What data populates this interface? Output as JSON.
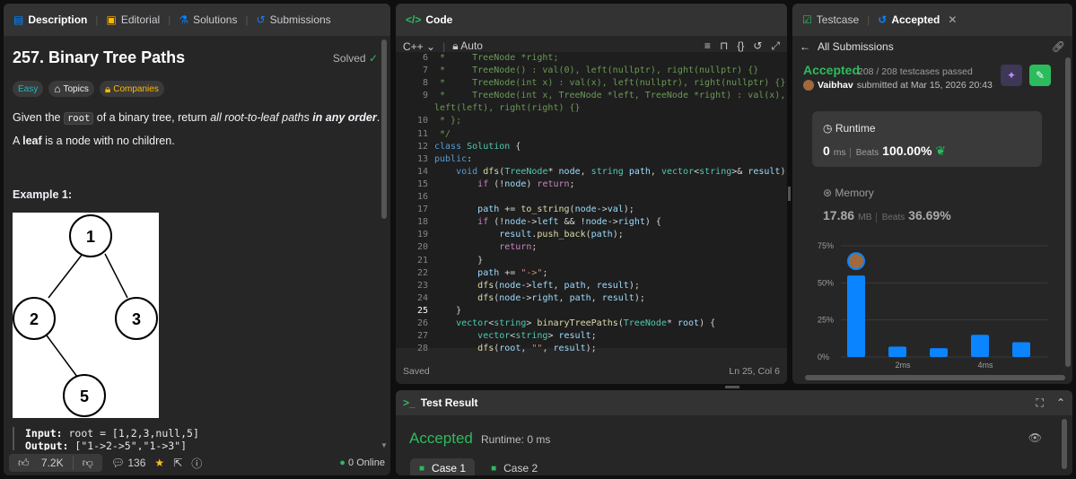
{
  "left_tabs": [
    {
      "label": "Description",
      "icon": "description-icon"
    },
    {
      "label": "Editorial",
      "icon": "editorial-icon"
    },
    {
      "label": "Solutions",
      "icon": "flask-icon"
    },
    {
      "label": "Submissions",
      "icon": "history-icon"
    }
  ],
  "problem": {
    "title": "257. Binary Tree Paths",
    "status": "Solved",
    "tags": [
      "Easy",
      "Topics",
      "Companies"
    ],
    "text_pre": "Given the ",
    "text_code": "root",
    "text_mid": " of a binary tree, return ",
    "text_em": "all root-to-leaf paths",
    "text_sp": " ",
    "text_bold_em": "in any order",
    "text_end": ".",
    "leaf_pre": "A ",
    "leaf_bold": "leaf",
    "leaf_post": " is a node with no children.",
    "example_title": "Example 1:",
    "tree_nodes": [
      "1",
      "2",
      "3",
      "5"
    ],
    "input_label": "Input:",
    "input_value": " root = [1,2,3,null,5]",
    "output_label": "Output:",
    "output_value": " [\"1->2->5\",\"1->3\"]"
  },
  "left_footer": {
    "likes": "7.2K",
    "comments": "136",
    "online": "0 Online"
  },
  "code_panel": {
    "title": "Code",
    "language": "C++",
    "mode": "Auto",
    "status": "Saved",
    "cursor": "Ln 25, Col 6",
    "line_numbers": [
      "6",
      "7",
      "8",
      "9",
      "",
      "10",
      "11",
      "12",
      "13",
      "14",
      "15",
      "16",
      "17",
      "18",
      "19",
      "20",
      "21",
      "22",
      "23",
      "24",
      "25",
      "26",
      "27",
      "28"
    ],
    "current_line": "25"
  },
  "right_panel": {
    "tabs": [
      {
        "label": "Testcase"
      },
      {
        "label": "Accepted"
      }
    ],
    "back_label": "All Submissions",
    "result": "Accepted",
    "passed": "208 / 208 testcases passed",
    "user": "Vaibhav",
    "submitted": "submitted at Mar 15, 2026 20:43",
    "runtime_label": "Runtime",
    "runtime_value": "0",
    "runtime_unit": "ms",
    "beats_label": "Beats",
    "runtime_beats": "100.00%",
    "memory_label": "Memory",
    "memory_value": "17.86",
    "memory_unit": "MB",
    "memory_beats": "36.69%"
  },
  "chart_data": {
    "type": "bar",
    "y_ticks": [
      "75%",
      "50%",
      "25%",
      "0%"
    ],
    "x_ticks": [
      "2ms",
      "4ms"
    ],
    "ylim": [
      0,
      75
    ],
    "values": [
      55,
      7,
      6,
      15,
      10
    ],
    "highlight_index": 0,
    "bar_color": "#0a84ff"
  },
  "result_panel": {
    "title": "Test Result",
    "result": "Accepted",
    "runtime": "Runtime: 0 ms",
    "cases": [
      "Case 1",
      "Case 2"
    ]
  },
  "colors": {
    "accent_green": "#2cbb5d",
    "bar_blue": "#0a84ff",
    "panel": "#262626"
  }
}
